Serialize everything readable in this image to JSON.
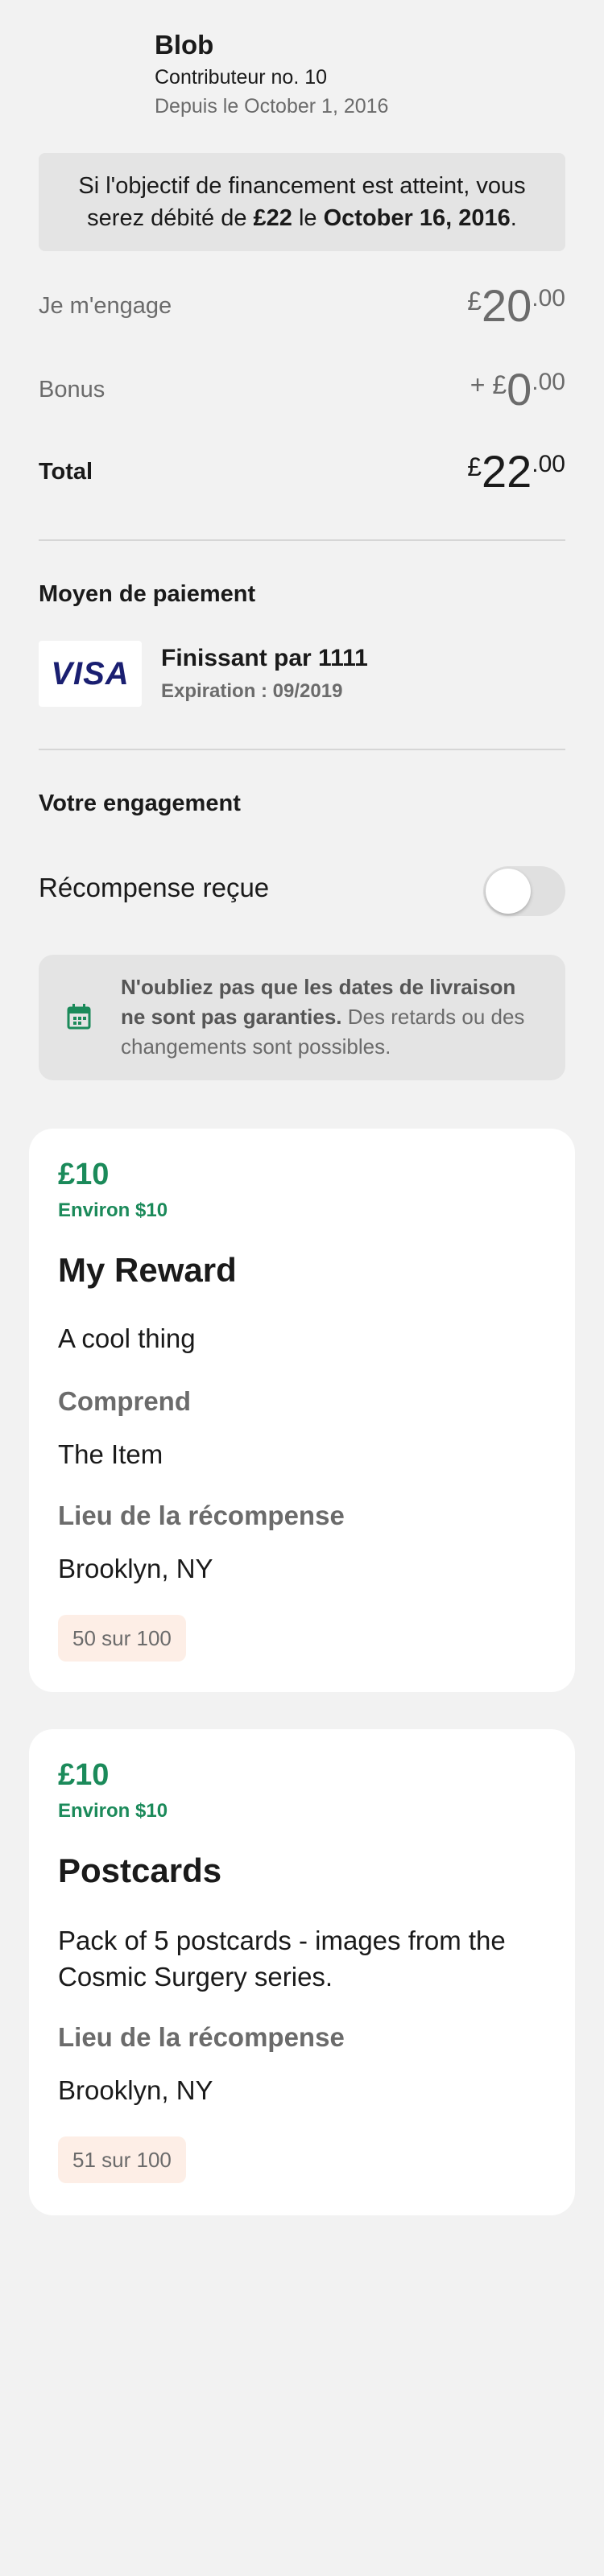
{
  "backer": {
    "name": "Blob",
    "number": "Contributeur no. 10",
    "since": "Depuis le October 1, 2016"
  },
  "notice": {
    "prefix": "Si l'objectif de financement est atteint, vous serez débité de ",
    "amount": "£22",
    "middle": " le ",
    "date": "October 16, 2016",
    "suffix": "."
  },
  "amounts": {
    "pledge": {
      "label": "Je m'engage",
      "prefix": "",
      "currency": "£",
      "integer": "20",
      "decimal": ".00"
    },
    "bonus": {
      "label": "Bonus",
      "prefix": "+ ",
      "currency": "£",
      "integer": "0",
      "decimal": ".00"
    },
    "total": {
      "label": "Total",
      "prefix": "",
      "currency": "£",
      "integer": "22",
      "decimal": ".00"
    }
  },
  "payment": {
    "section_title": "Moyen de paiement",
    "card_brand": "VISA",
    "card_ending": "Finissant par 1111",
    "expiration": "Expiration : 09/2019"
  },
  "engagement": {
    "section_title": "Votre engagement",
    "reward_received_label": "Récompense reçue",
    "reward_received": false
  },
  "delivery_warning": {
    "icon": "calendar-icon",
    "bold": "N'oubliez pas que les dates de livraison ne sont pas garanties.",
    "text": " Des retards ou des changements sont possibles."
  },
  "rewards": [
    {
      "price": "£10",
      "approx": "Environ $10",
      "title": "My Reward",
      "description": "A cool thing",
      "includes_label": "Comprend",
      "includes_value": "The Item",
      "location_label": "Lieu de la récompense",
      "location_value": "Brooklyn, NY",
      "badge": "50 sur 100"
    },
    {
      "price": "£10",
      "approx": "Environ $10",
      "title": "Postcards",
      "description": "Pack of 5 postcards - images from the Cosmic Surgery series.",
      "location_label": "Lieu de la récompense",
      "location_value": "Brooklyn, NY",
      "badge": "51 sur 100"
    }
  ],
  "colors": {
    "background": "#f2f2f2",
    "accent_green": "#1b8a5a",
    "visa_blue": "#1a1f71",
    "badge_bg": "#fdeee6"
  }
}
